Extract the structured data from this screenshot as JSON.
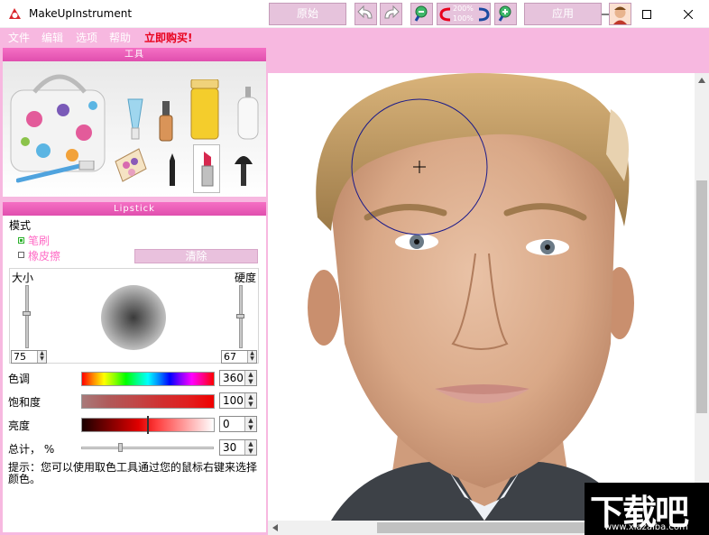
{
  "window": {
    "title": "MakeUpInstrument"
  },
  "menu": [
    "文件",
    "编辑",
    "选项",
    "帮助"
  ],
  "menu_buy": "立即购买!",
  "tools_section": {
    "header": "工具"
  },
  "lipstick_section": {
    "header": "Lipstick",
    "mode_label": "模式",
    "mode_brush": "笔刷",
    "mode_eraser": "橡皮擦",
    "clear_button": "清除",
    "size_label": "大小",
    "hardness_label": "硬度",
    "size_value": "75",
    "hardness_value": "67",
    "size_level": 0.5,
    "hardness_level": 0.6,
    "hue_label": "色调",
    "hue_value": "360",
    "saturation_label": "饱和度",
    "saturation_value": "100",
    "brightness_label": "亮度",
    "brightness_value": "0",
    "total_label": "总计，   %",
    "total_value": "30",
    "tip": "提示：您可以使用取色工具通过您的鼠标右键来选择颜色。"
  },
  "toolbar": {
    "original_button": "原始",
    "apply_button": "应用",
    "zoom_200": "200%",
    "zoom_100": "100%"
  },
  "watermark": {
    "main": "下载吧",
    "url": "www.xiazaiba.com"
  },
  "colors": {
    "panel_pink": "#f7b8e0",
    "header_pink": "#e04fae",
    "menu_buy_red": "#e8001c"
  },
  "icons": [
    "undo-icon",
    "redo-icon",
    "zoom-out-icon",
    "zoom-toggle-icon",
    "zoom-in-icon",
    "face-icon"
  ]
}
